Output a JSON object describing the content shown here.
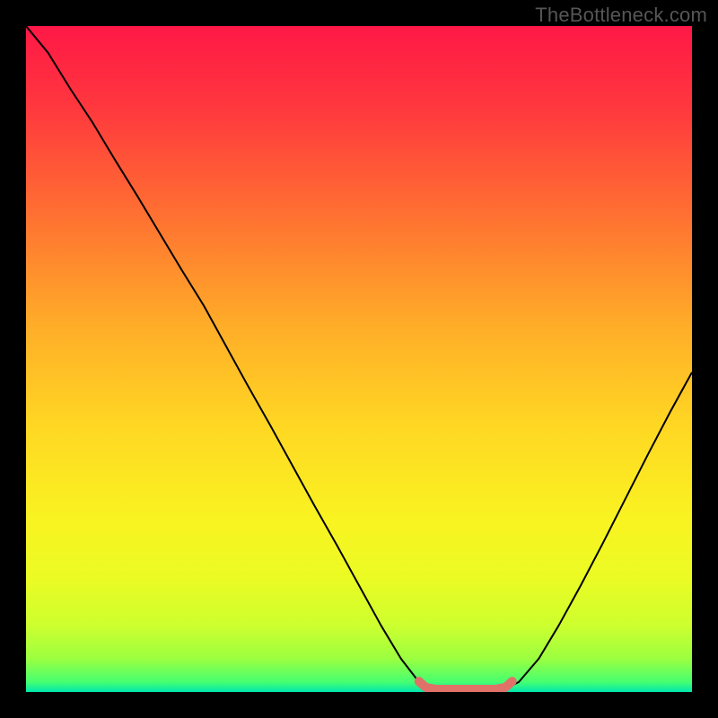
{
  "watermark": "TheBottleneck.com",
  "chart_data": {
    "type": "line",
    "title": "",
    "xlabel": "",
    "ylabel": "",
    "xlim": [
      0,
      100
    ],
    "ylim": [
      0,
      100
    ],
    "grid": false,
    "legend": false,
    "background_gradient": {
      "description": "vertical rainbow heatmap, red at top, green at bottom",
      "stops": [
        {
          "offset": 0.0,
          "color": "#ff1846"
        },
        {
          "offset": 0.12,
          "color": "#ff373e"
        },
        {
          "offset": 0.28,
          "color": "#ff6f32"
        },
        {
          "offset": 0.45,
          "color": "#ffad28"
        },
        {
          "offset": 0.6,
          "color": "#ffd723"
        },
        {
          "offset": 0.74,
          "color": "#f9f321"
        },
        {
          "offset": 0.83,
          "color": "#ebfb24"
        },
        {
          "offset": 0.9,
          "color": "#cdff2e"
        },
        {
          "offset": 0.95,
          "color": "#9cff40"
        },
        {
          "offset": 0.985,
          "color": "#45ff70"
        },
        {
          "offset": 1.0,
          "color": "#00e6b0"
        }
      ]
    },
    "series": [
      {
        "name": "bottleneck-curve",
        "color": "#000000",
        "stroke_width": 2,
        "x": [
          0.0,
          3.3,
          6.7,
          10.0,
          13.3,
          16.7,
          20.0,
          23.3,
          26.7,
          30.0,
          33.3,
          36.7,
          40.0,
          43.3,
          46.7,
          50.0,
          53.3,
          56.3,
          59.0,
          62.0,
          65.0,
          68.0,
          71.0,
          74.0,
          77.0,
          80.0,
          83.3,
          86.7,
          90.0,
          93.3,
          96.7,
          100.0
        ],
        "y": [
          100.0,
          96.0,
          90.5,
          85.5,
          80.0,
          74.5,
          69.0,
          63.5,
          58.0,
          52.0,
          46.0,
          40.0,
          34.0,
          28.0,
          22.0,
          16.0,
          10.0,
          5.0,
          1.5,
          0.0,
          0.0,
          0.0,
          0.0,
          1.5,
          5.0,
          10.0,
          16.0,
          22.5,
          29.0,
          35.5,
          42.0,
          48.0
        ]
      },
      {
        "name": "optimal-range-marker",
        "color": "#e07168",
        "stroke_width": 10,
        "linecap": "round",
        "x": [
          59.0,
          60.0,
          61.5,
          70.5,
          72.0,
          73.0
        ],
        "y": [
          1.6,
          0.7,
          0.4,
          0.4,
          0.7,
          1.6
        ]
      }
    ]
  }
}
